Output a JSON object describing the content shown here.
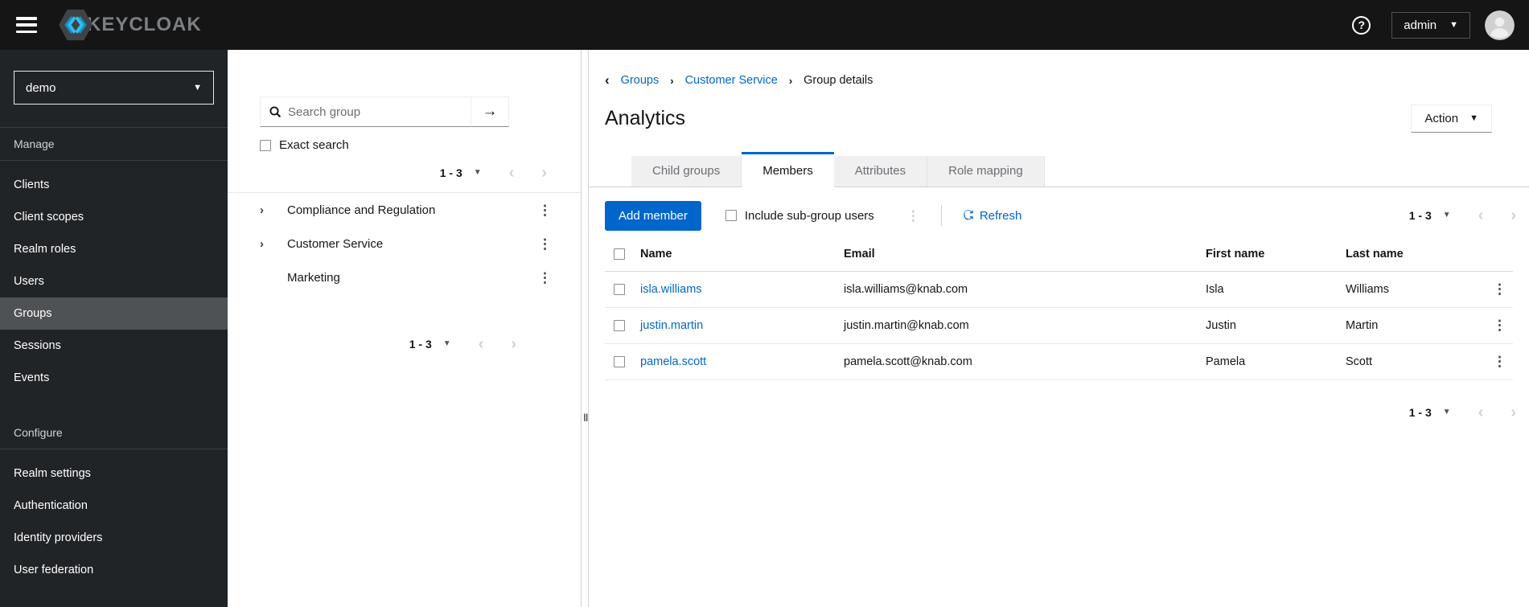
{
  "topbar": {
    "brand_text": "KEYCLOAK",
    "username": "admin",
    "help_glyph": "?"
  },
  "realm_selector": {
    "value": "demo"
  },
  "sidebar": {
    "sections": [
      {
        "label": "Manage",
        "items": [
          "Clients",
          "Client scopes",
          "Realm roles",
          "Users",
          "Groups",
          "Sessions",
          "Events"
        ]
      },
      {
        "label": "Configure",
        "items": [
          "Realm settings",
          "Authentication",
          "Identity providers",
          "User federation"
        ]
      }
    ],
    "active_item": "Groups"
  },
  "tree_panel": {
    "search_placeholder": "Search group",
    "exact_search_label": "Exact search",
    "pagination_range": "1 - 3",
    "groups": [
      {
        "name": "Compliance and Regulation",
        "expandable": true
      },
      {
        "name": "Customer Service",
        "expandable": true
      },
      {
        "name": "Marketing",
        "expandable": false
      }
    ]
  },
  "breadcrumb": {
    "links": [
      "Groups",
      "Customer Service"
    ],
    "current": "Group details"
  },
  "page": {
    "title": "Analytics",
    "action_label": "Action"
  },
  "tabs": {
    "labels": [
      "Child groups",
      "Members",
      "Attributes",
      "Role mapping"
    ],
    "active": "Members"
  },
  "toolbar": {
    "add_member_label": "Add member",
    "include_subgroups_label": "Include sub-group users",
    "refresh_label": "Refresh",
    "pagination_range": "1 - 3"
  },
  "table": {
    "headers": {
      "name": "Name",
      "email": "Email",
      "first": "First name",
      "last": "Last name"
    },
    "rows": [
      {
        "name": "isla.williams",
        "email": "isla.williams@knab.com",
        "first": "Isla",
        "last": "Williams"
      },
      {
        "name": "justin.martin",
        "email": "justin.martin@knab.com",
        "first": "Justin",
        "last": "Martin"
      },
      {
        "name": "pamela.scott",
        "email": "pamela.scott@knab.com",
        "first": "Pamela",
        "last": "Scott"
      }
    ],
    "pagination_range": "1 - 3"
  },
  "icons": {
    "kebab_glyph": "⋮",
    "caret_glyph": "▼",
    "chevron_left_glyph": "‹",
    "chevron_right_glyph": "›",
    "breadcrumb_sep_glyph": "›",
    "back_glyph": "‹",
    "arrow_submit_glyph": "→",
    "grip_glyph": "❚❚"
  },
  "colors": {
    "accent": "#0066cc",
    "topbar_bg": "#151515",
    "sidebar_bg": "#212427",
    "nav_active_bg": "#4f5255",
    "tab_inactive_bg": "#f0f0f0",
    "link": "#0066cc"
  }
}
